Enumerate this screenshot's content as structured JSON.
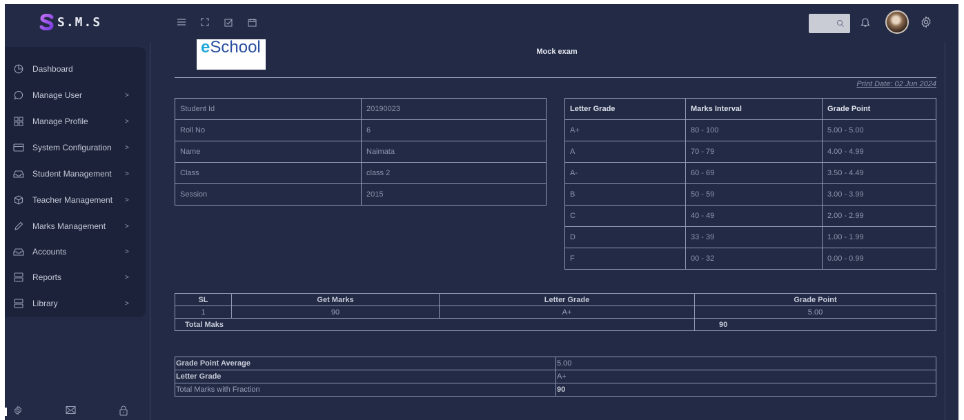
{
  "app": {
    "brand": "S.M.S",
    "brand_color": "#a85cf0"
  },
  "header": {
    "icons": [
      "hamburger-icon",
      "fullscreen-icon",
      "checkbox-icon",
      "calendar-icon"
    ],
    "search_icon": "search-icon",
    "bell_icon": "bell-icon",
    "settings_icon": "gear-icon"
  },
  "sidebar": {
    "items": [
      {
        "label": "Dashboard",
        "icon": "pie-chart-icon",
        "has_chevron": false
      },
      {
        "label": "Manage User",
        "icon": "chat-bubble-icon",
        "has_chevron": true
      },
      {
        "label": "Manage Profile",
        "icon": "grid-icon",
        "has_chevron": true
      },
      {
        "label": "System Configuration",
        "icon": "credit-card-icon",
        "has_chevron": true
      },
      {
        "label": "Student Management",
        "icon": "inbox-icon",
        "has_chevron": true
      },
      {
        "label": "Teacher Management",
        "icon": "box-icon",
        "has_chevron": true
      },
      {
        "label": "Marks Management",
        "icon": "pen-icon",
        "has_chevron": true
      },
      {
        "label": "Accounts",
        "icon": "tray-icon",
        "has_chevron": true
      },
      {
        "label": "Reports",
        "icon": "server-icon",
        "has_chevron": true
      },
      {
        "label": "Library",
        "icon": "server-icon",
        "has_chevron": true
      }
    ],
    "chevron": ">",
    "bottom_icons": [
      "gear-icon",
      "mail-icon",
      "lock-icon"
    ]
  },
  "report": {
    "school_logo_text_e": "e",
    "school_logo_text": "School",
    "exam_title": "Mock exam",
    "print_date_label": "Print Date:",
    "print_date": " 02 Jun 2024",
    "student_info": [
      {
        "key": "Student Id",
        "value": "20190023"
      },
      {
        "key": "Roll No",
        "value": "6"
      },
      {
        "key": "Name",
        "value": "Naimata"
      },
      {
        "key": "Class",
        "value": "class 2"
      },
      {
        "key": "Session",
        "value": "2015"
      }
    ],
    "grade_table": {
      "headers": [
        "Letter Grade",
        "Marks Interval",
        "Grade Point"
      ],
      "rows": [
        [
          "A+",
          "80 - 100",
          "5.00 - 5.00"
        ],
        [
          "A",
          "70 - 79",
          "4.00 - 4.99"
        ],
        [
          "A-",
          "60 - 69",
          "3.50 - 4.49"
        ],
        [
          "B",
          "50 - 59",
          "3.00 - 3.99"
        ],
        [
          "C",
          "40 - 49",
          "2.00 - 2.99"
        ],
        [
          "D",
          "33 - 39",
          "1.00 - 1.99"
        ],
        [
          "F",
          "00 - 32",
          "0.00 - 0.99"
        ]
      ]
    },
    "marks_table": {
      "headers": [
        "SL",
        "Get Marks",
        "Letter Grade",
        "Grade Point"
      ],
      "rows": [
        [
          "1",
          "90",
          "A+",
          "5.00"
        ]
      ],
      "total_label": "Total Maks",
      "total_value": "90"
    },
    "summary": [
      {
        "key": "Grade Point Average",
        "value": "5.00",
        "key_bold": true,
        "value_bold": false
      },
      {
        "key": "Letter Grade",
        "value": "A+",
        "key_bold": true,
        "value_bold": false
      },
      {
        "key": "Total Marks with Fraction",
        "value": "90",
        "key_bold": false,
        "value_bold": true
      }
    ]
  }
}
